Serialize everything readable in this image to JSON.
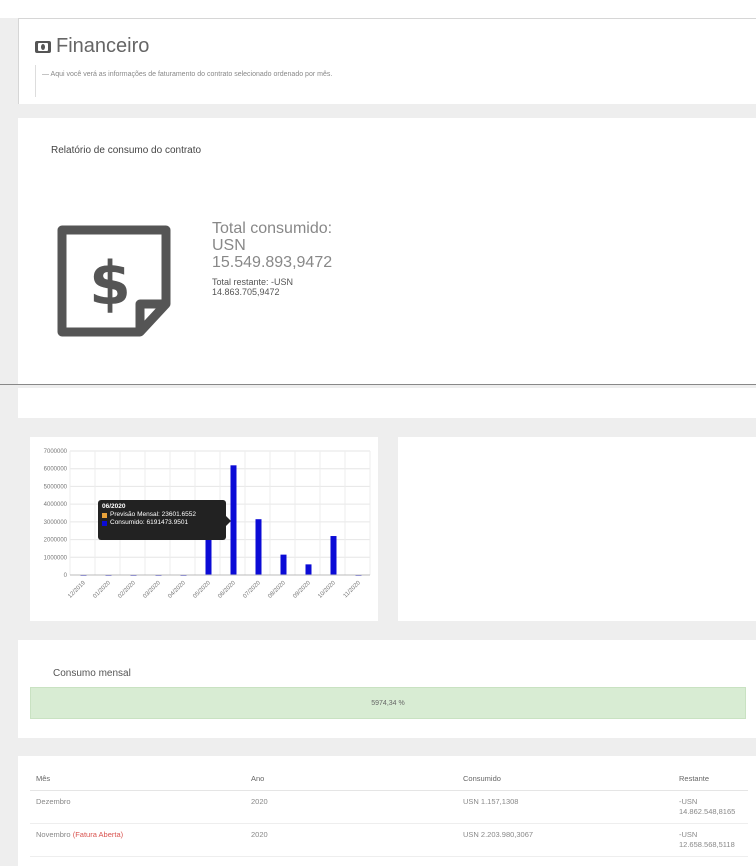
{
  "header": {
    "title": "Financeiro",
    "subtitle": "— Aqui você verá as informações de faturamento do contrato selecionado ordenado por mês."
  },
  "relatorio": {
    "title": "Relatório de consumo do contrato",
    "total_label": "Total consumido:",
    "total_currency": "USN",
    "total_value": "15.549.893,9472",
    "remaining_label": "Total restante: -USN",
    "remaining_value": "14.863.705,9472"
  },
  "chart_data": {
    "type": "bar",
    "categories": [
      "12/2019",
      "01/2020",
      "02/2020",
      "03/2020",
      "04/2020",
      "05/2020",
      "06/2020",
      "07/2020",
      "08/2020",
      "09/2020",
      "10/2020",
      "11/2020"
    ],
    "series": [
      {
        "name": "Previsão Mensal",
        "color": "#e8a23a",
        "values": [
          23601.6552,
          23601.6552,
          23601.6552,
          23601.6552,
          23601.6552,
          23601.6552,
          23601.6552,
          23601.6552,
          23601.6552,
          23601.6552,
          23601.6552,
          23601.6552
        ]
      },
      {
        "name": "Consumido",
        "color": "#0b0bd6",
        "values": [
          0,
          0,
          0,
          0,
          0,
          2700000,
          6191473.9501,
          3150000,
          1150000,
          600000,
          2200000,
          0
        ]
      }
    ],
    "yticks": [
      0,
      1000000,
      2000000,
      3000000,
      4000000,
      5000000,
      6000000,
      7000000
    ],
    "ylim": [
      0,
      7000000
    ],
    "grid": true,
    "tooltip": {
      "title": "06/2020",
      "line1": "Previsão Mensal: 23601.6552",
      "line2": "Consumido: 6191473.9501"
    }
  },
  "consumo": {
    "title": "Consumo mensal",
    "percent_text": "5974,34 %",
    "fill_fraction": 1.0
  },
  "table": {
    "headers": [
      "Mês",
      "Ano",
      "Consumido",
      "Restante"
    ],
    "rows": [
      {
        "mes": "Dezembro",
        "status": "",
        "ano": "2020",
        "consumido": "USN 1.157,1308",
        "restante_1": "-USN",
        "restante_2": "14.862.548,8165"
      },
      {
        "mes": "Novembro",
        "status": "(Fatura Aberta)",
        "ano": "2020",
        "consumido": "USN 2.203.980,3067",
        "restante_1": "-USN",
        "restante_2": "12.658.568,5118"
      }
    ]
  }
}
